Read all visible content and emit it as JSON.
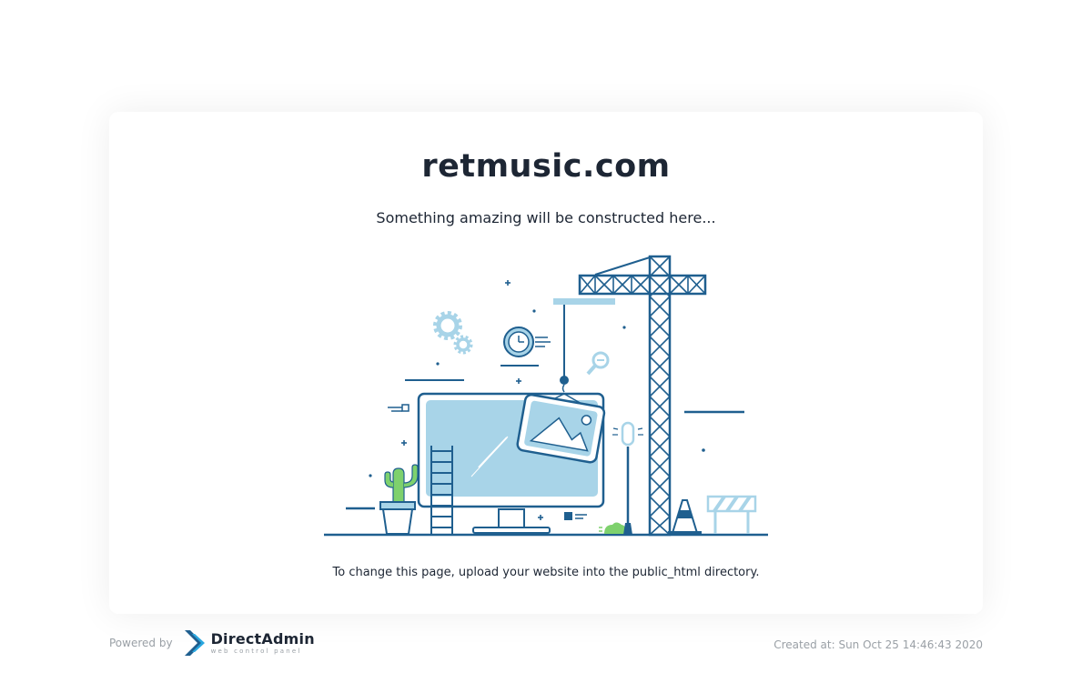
{
  "page": {
    "title": "retmusic.com",
    "subtitle": "Something amazing will be constructed here...",
    "hint": "To change this page, upload your website into the public_html directory."
  },
  "footer": {
    "powered_by": "Powered by",
    "brand_name": "DirectAdmin",
    "brand_tagline": "web control panel",
    "created_at": "Created at: Sun Oct 25 14:46:43 2020"
  },
  "illustration": {
    "icon": "construction-illustration"
  },
  "colors": {
    "dark_blue": "#1f5f8f",
    "light_blue": "#a8d4e8",
    "cactus_green": "#7ed16d",
    "text_dark": "#1d2634",
    "text_muted": "#9aa0a6"
  }
}
